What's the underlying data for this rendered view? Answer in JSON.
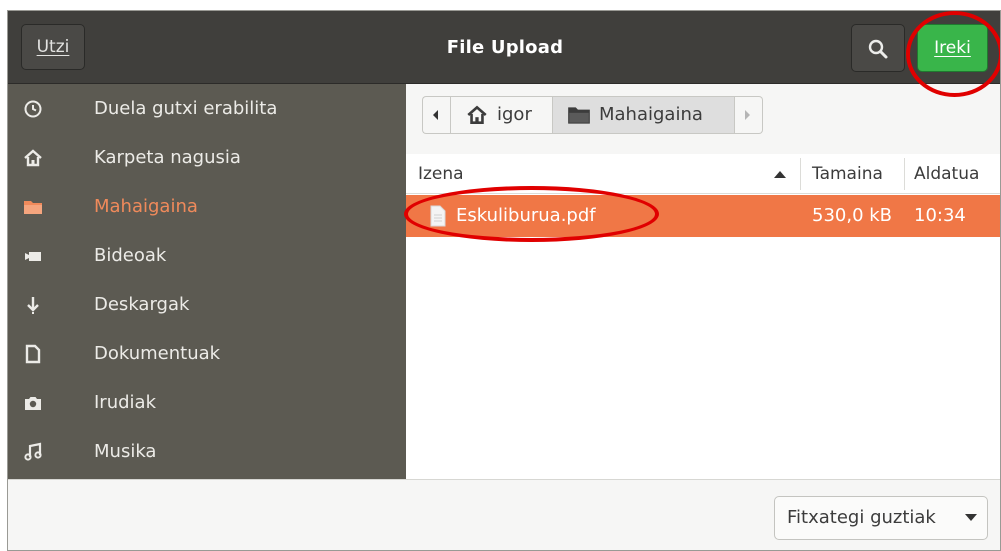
{
  "window": {
    "title": "File Upload"
  },
  "header": {
    "cancel_label": "Utzi",
    "open_label": "Ireki",
    "search_icon": "search-icon"
  },
  "sidebar": {
    "items": [
      {
        "label": "Duela gutxi erabilita",
        "icon": "clock-icon"
      },
      {
        "label": "Karpeta nagusia",
        "icon": "home-icon"
      },
      {
        "label": "Mahaigaina",
        "icon": "folder-icon",
        "active": true
      },
      {
        "label": "Bideoak",
        "icon": "video-camera-icon"
      },
      {
        "label": "Deskargak",
        "icon": "download-icon"
      },
      {
        "label": "Dokumentuak",
        "icon": "document-icon"
      },
      {
        "label": "Irudiak",
        "icon": "camera-icon"
      },
      {
        "label": "Musika",
        "icon": "music-icon"
      }
    ]
  },
  "pathbar": {
    "crumbs": [
      {
        "label": "igor",
        "icon": "home-icon"
      },
      {
        "label": "Mahaigaina",
        "icon": "folder-icon"
      }
    ]
  },
  "columns": {
    "name": "Izena",
    "size": "Tamaina",
    "modified": "Aldatua"
  },
  "files": [
    {
      "name": "Eskuliburua.pdf",
      "size": "530,0 kB",
      "modified": "10:34",
      "selected": true
    }
  ],
  "footer": {
    "filter_label": "Fitxategi guztiak"
  },
  "colors": {
    "accent": "#f07746",
    "open_button": "#39b54a",
    "sidebar_bg": "#5c5a52",
    "header_bg": "#403f3c",
    "annotation": "#e00000"
  }
}
